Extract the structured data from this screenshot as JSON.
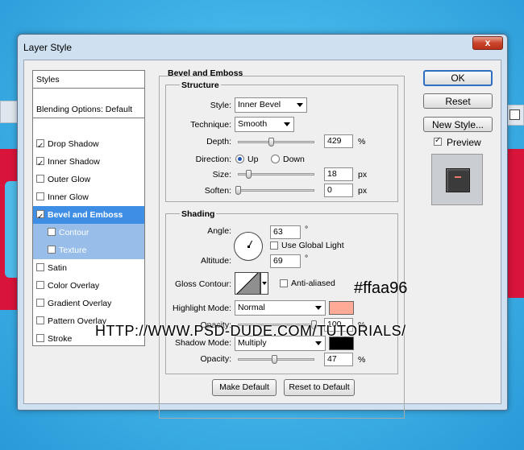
{
  "window": {
    "title": "Layer Style",
    "close_glyph": "x"
  },
  "styles_panel": {
    "header": "Styles",
    "blending": "Blending Options: Default",
    "items": [
      {
        "label": "Drop Shadow",
        "checked": true
      },
      {
        "label": "Inner Shadow",
        "checked": true
      },
      {
        "label": "Outer Glow",
        "checked": false
      },
      {
        "label": "Inner Glow",
        "checked": false
      },
      {
        "label": "Bevel and Emboss",
        "checked": true,
        "selected": true
      },
      {
        "label": "Contour",
        "checked": false,
        "sub": true
      },
      {
        "label": "Texture",
        "checked": false,
        "sub": true
      },
      {
        "label": "Satin",
        "checked": false
      },
      {
        "label": "Color Overlay",
        "checked": false
      },
      {
        "label": "Gradient Overlay",
        "checked": false
      },
      {
        "label": "Pattern Overlay",
        "checked": false
      },
      {
        "label": "Stroke",
        "checked": false
      }
    ]
  },
  "bevel": {
    "title": "Bevel and Emboss",
    "structure": {
      "title": "Structure",
      "style_label": "Style:",
      "style_value": "Inner Bevel",
      "technique_label": "Technique:",
      "technique_value": "Smooth",
      "depth_label": "Depth:",
      "depth_value": "429",
      "depth_unit": "%",
      "direction_label": "Direction:",
      "direction_up": "Up",
      "direction_down": "Down",
      "size_label": "Size:",
      "size_value": "18",
      "size_unit": "px",
      "soften_label": "Soften:",
      "soften_value": "0",
      "soften_unit": "px"
    },
    "shading": {
      "title": "Shading",
      "angle_label": "Angle:",
      "angle_value": "63",
      "angle_unit": "°",
      "use_global_light": "Use Global Light",
      "altitude_label": "Altitude:",
      "altitude_value": "69",
      "altitude_unit": "°",
      "gloss_contour_label": "Gloss Contour:",
      "anti_aliased": "Anti-aliased",
      "highlight_mode_label": "Highlight Mode:",
      "highlight_mode_value": "Normal",
      "highlight_color": "#ffaa96",
      "opacity_label": "Opacity:",
      "highlight_opacity_value": "100",
      "opacity_unit": "%",
      "shadow_mode_label": "Shadow Mode:",
      "shadow_mode_value": "Multiply",
      "shadow_color": "#000000",
      "shadow_opacity_value": "47"
    },
    "make_default": "Make Default",
    "reset_to_default": "Reset to Default"
  },
  "buttons": {
    "ok": "OK",
    "reset": "Reset",
    "new_style": "New Style...",
    "preview": "Preview"
  },
  "overlay": {
    "hex": "#ffaa96",
    "url": "HTTP://WWW.PSD-DUDE.COM/TUTORIALS/"
  },
  "colors": {
    "selection": "#3f8ee5",
    "sub_selection": "#97bde8",
    "accent_red": "#d8143a"
  }
}
